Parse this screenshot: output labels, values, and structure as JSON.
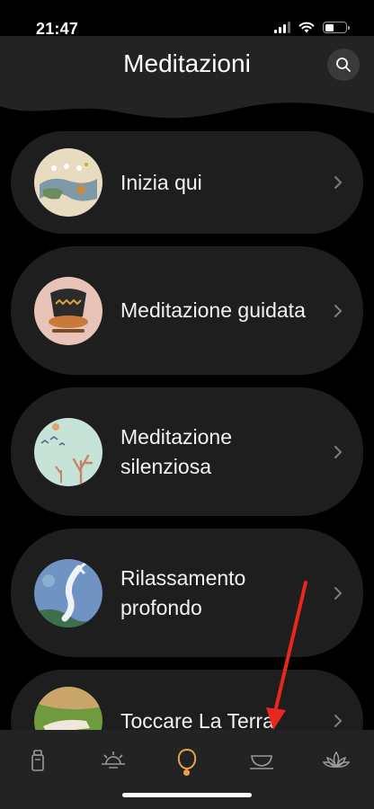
{
  "status_bar": {
    "time": "21:47",
    "battery_level": 0.45
  },
  "header": {
    "title": "Meditazioni",
    "search_icon": "search-icon"
  },
  "items": [
    {
      "label": "Inizia qui",
      "thumb": "landscape-illustration"
    },
    {
      "label": "Meditazione guidata",
      "thumb": "meditating-figure-illustration"
    },
    {
      "label": "Meditazione silenziosa",
      "thumb": "birds-coral-illustration"
    },
    {
      "label": "Rilassamento profondo",
      "thumb": "koi-fish-illustration"
    },
    {
      "label": "Toccare La Terra",
      "thumb": "hand-on-grass-illustration"
    }
  ],
  "tabbar": {
    "tabs": [
      {
        "name": "bottle-icon"
      },
      {
        "name": "sun-icon"
      },
      {
        "name": "bell-icon",
        "active": true
      },
      {
        "name": "tea-cup-icon"
      },
      {
        "name": "lotus-icon"
      }
    ],
    "active_color": "#e6a34a"
  },
  "colors": {
    "background": "#000000",
    "card": "#1e1e1e",
    "header": "#232323",
    "annotation": "#e8271d"
  }
}
